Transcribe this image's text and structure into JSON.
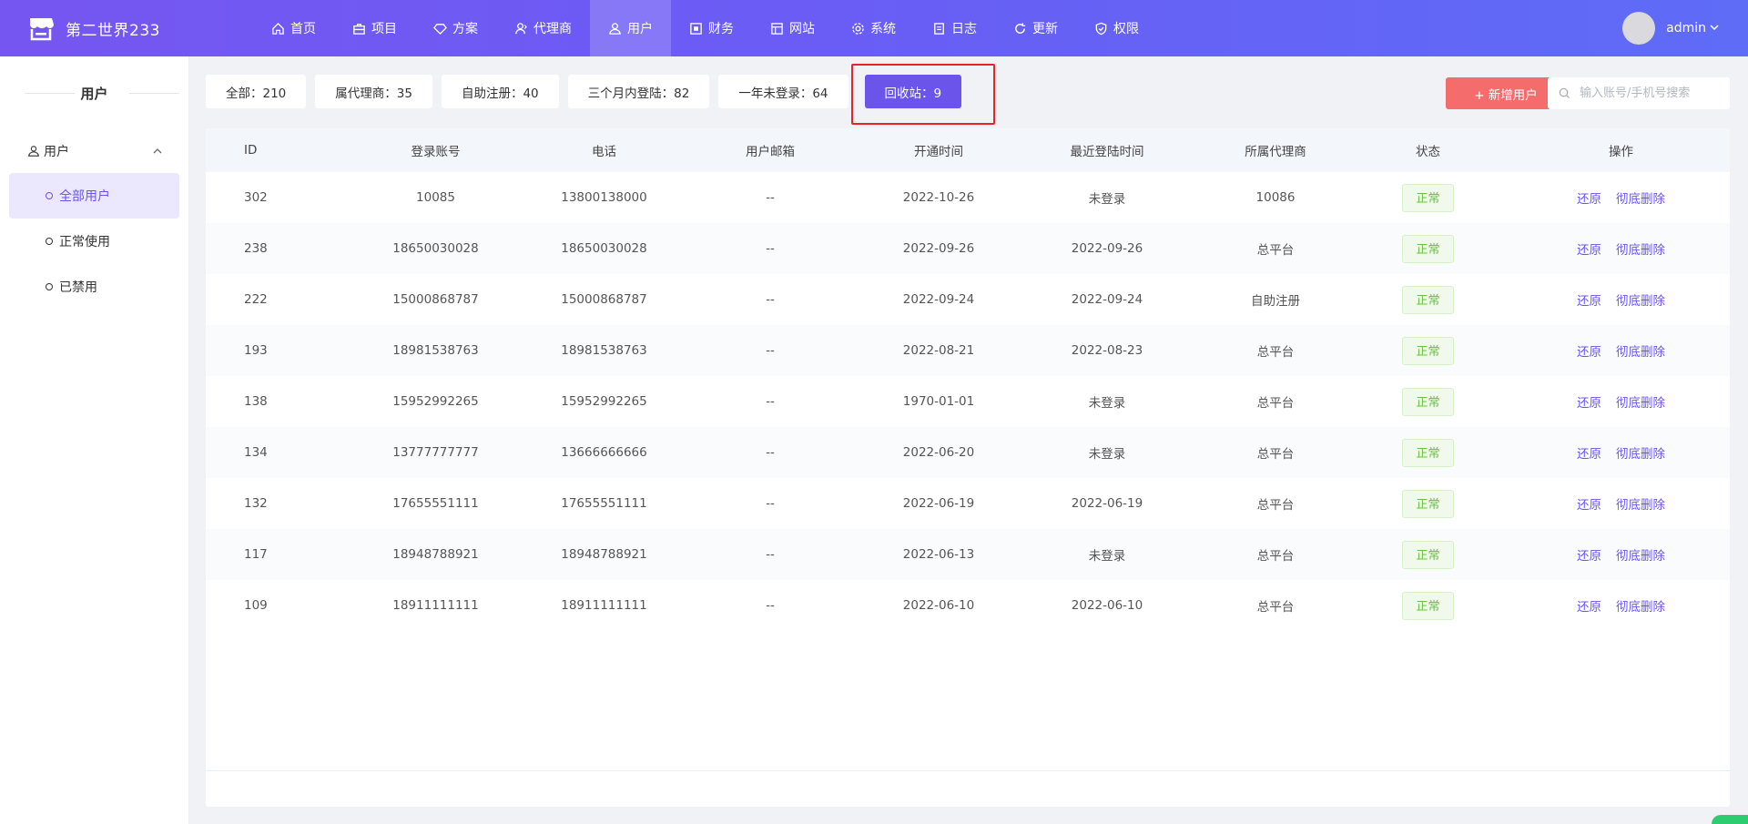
{
  "header": {
    "brand": "第二世界233",
    "nav": [
      {
        "label": "首页",
        "icon": "home-icon",
        "active": false
      },
      {
        "label": "项目",
        "icon": "briefcase-icon",
        "active": false
      },
      {
        "label": "方案",
        "icon": "diamond-icon",
        "active": false
      },
      {
        "label": "代理商",
        "icon": "agent-icon",
        "active": false
      },
      {
        "label": "用户",
        "icon": "users-icon",
        "active": true
      },
      {
        "label": "财务",
        "icon": "finance-icon",
        "active": false
      },
      {
        "label": "网站",
        "icon": "layout-icon",
        "active": false
      },
      {
        "label": "系统",
        "icon": "gear-icon",
        "active": false
      },
      {
        "label": "日志",
        "icon": "document-icon",
        "active": false
      },
      {
        "label": "更新",
        "icon": "refresh-icon",
        "active": false
      },
      {
        "label": "权限",
        "icon": "shield-icon",
        "active": false
      }
    ],
    "user": "admin"
  },
  "sidebar": {
    "title": "用户",
    "group": "用户",
    "items": [
      {
        "label": "全部用户",
        "active": true
      },
      {
        "label": "正常使用",
        "active": false
      },
      {
        "label": "已禁用",
        "active": false
      }
    ]
  },
  "filters": [
    {
      "label": "全部：210",
      "active": false
    },
    {
      "label": "属代理商：35",
      "active": false
    },
    {
      "label": "自助注册：40",
      "active": false
    },
    {
      "label": "三个月内登陆：82",
      "active": false
    },
    {
      "label": "一年未登录：64",
      "active": false
    },
    {
      "label": "回收站：9",
      "active": true
    }
  ],
  "toolbar": {
    "add_label": "+ 新增用户",
    "search_placeholder": "输入账号/手机号搜索"
  },
  "table": {
    "columns": [
      "ID",
      "登录账号",
      "电话",
      "用户邮箱",
      "开通时间",
      "最近登陆时间",
      "所属代理商",
      "状态",
      "操作"
    ],
    "rows": [
      {
        "id": "302",
        "account": "10085",
        "phone": "13800138000",
        "email": "--",
        "opened": "2022-10-26",
        "last_login": "未登录",
        "agent": "10086",
        "status": "正常"
      },
      {
        "id": "238",
        "account": "18650030028",
        "phone": "18650030028",
        "email": "--",
        "opened": "2022-09-26",
        "last_login": "2022-09-26",
        "agent": "总平台",
        "status": "正常"
      },
      {
        "id": "222",
        "account": "15000868787",
        "phone": "15000868787",
        "email": "--",
        "opened": "2022-09-24",
        "last_login": "2022-09-24",
        "agent": "自助注册",
        "status": "正常"
      },
      {
        "id": "193",
        "account": "18981538763",
        "phone": "18981538763",
        "email": "--",
        "opened": "2022-08-21",
        "last_login": "2022-08-23",
        "agent": "总平台",
        "status": "正常"
      },
      {
        "id": "138",
        "account": "15952992265",
        "phone": "15952992265",
        "email": "--",
        "opened": "1970-01-01",
        "last_login": "未登录",
        "agent": "总平台",
        "status": "正常"
      },
      {
        "id": "134",
        "account": "13777777777",
        "phone": "13666666666",
        "email": "--",
        "opened": "2022-06-20",
        "last_login": "未登录",
        "agent": "总平台",
        "status": "正常"
      },
      {
        "id": "132",
        "account": "17655551111",
        "phone": "17655551111",
        "email": "--",
        "opened": "2022-06-19",
        "last_login": "2022-06-19",
        "agent": "总平台",
        "status": "正常"
      },
      {
        "id": "117",
        "account": "18948788921",
        "phone": "18948788921",
        "email": "--",
        "opened": "2022-06-13",
        "last_login": "未登录",
        "agent": "总平台",
        "status": "正常"
      },
      {
        "id": "109",
        "account": "18911111111",
        "phone": "18911111111",
        "email": "--",
        "opened": "2022-06-10",
        "last_login": "2022-06-10",
        "agent": "总平台",
        "status": "正常"
      }
    ],
    "actions": {
      "restore": "还原",
      "delete": "彻底删除"
    }
  },
  "colors": {
    "primary": "#6b54ea",
    "danger": "#f56c6c",
    "success": "#67c23a"
  }
}
